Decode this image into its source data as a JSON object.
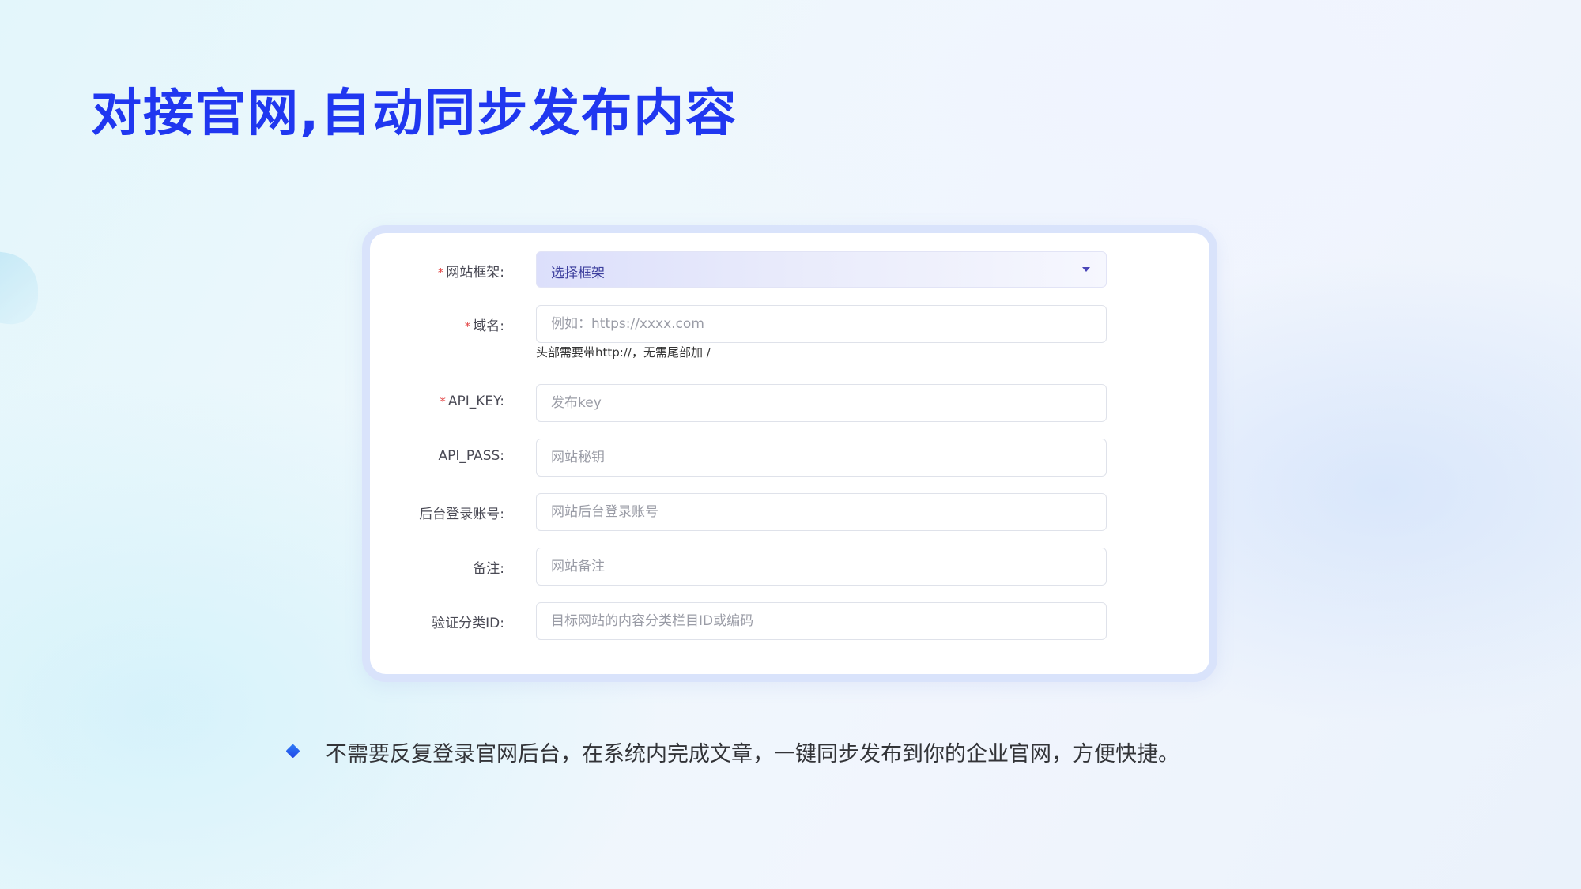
{
  "page": {
    "title": "对接官网,自动同步发布内容"
  },
  "form": {
    "required_mark": "*",
    "framework": {
      "label": "网站框架:",
      "value": "选择框架"
    },
    "domain": {
      "label": "域名:",
      "placeholder": "例如：https://xxxx.com",
      "help": "头部需要带http://，无需尾部加 /"
    },
    "api_key": {
      "label": "API_KEY:",
      "placeholder": "发布key"
    },
    "api_pass": {
      "label": "API_PASS:",
      "placeholder": "网站秘钥"
    },
    "admin_account": {
      "label": "后台登录账号:",
      "placeholder": "网站后台登录账号"
    },
    "remark": {
      "label": "备注:",
      "placeholder": "网站备注"
    },
    "category_id": {
      "label": "验证分类ID:",
      "placeholder": "目标网站的内容分类栏目ID或编码"
    }
  },
  "bullet": {
    "text": "不需要反复登录官网后台，在系统内完成文章，一键同步发布到你的企业官网，方便快捷。"
  },
  "colors": {
    "title": "#2037f0",
    "required": "#e34848",
    "card_border": "#d9e3fb",
    "select_bg": "#dcdffb"
  }
}
